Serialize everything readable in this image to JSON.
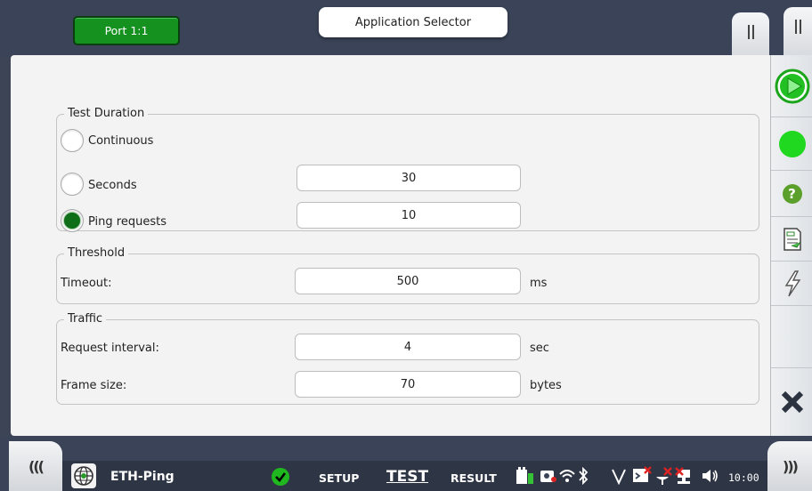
{
  "header": {
    "port_label": "Port 1:1",
    "app_selector_label": "Application Selector"
  },
  "test_duration": {
    "title": "Test Duration",
    "continuous_label": "Continuous",
    "seconds_label": "Seconds",
    "seconds_value": "30",
    "ping_requests_label": "Ping requests",
    "ping_requests_value": "10",
    "selected": "Ping requests"
  },
  "threshold": {
    "title": "Threshold",
    "timeout_label": "Timeout:",
    "timeout_value": "500",
    "timeout_unit": "ms"
  },
  "traffic": {
    "title": "Traffic",
    "request_interval_label": "Request interval:",
    "request_interval_value": "4",
    "request_interval_unit": "sec",
    "frame_size_label": "Frame size:",
    "frame_size_value": "70",
    "frame_size_unit": "bytes"
  },
  "right_bar": {
    "items": [
      "play-icon",
      "status-led-icon",
      "help-icon",
      "report-icon",
      "lightning-icon",
      "close-icon"
    ],
    "help_glyph": "?"
  },
  "bottom_bar": {
    "left_nav": "(((",
    "right_nav": ")))",
    "app_name": "ETH-Ping",
    "tab_setup": "SETUP",
    "tab_test": "TEST",
    "tab_result": "RESULT",
    "active_tab": "TEST",
    "clock": "10:00"
  },
  "colors": {
    "accent_green": "#14911f",
    "status_green": "#1fd81f",
    "chrome_dark": "#3a4357",
    "panel_bg": "#f3f3f3"
  }
}
